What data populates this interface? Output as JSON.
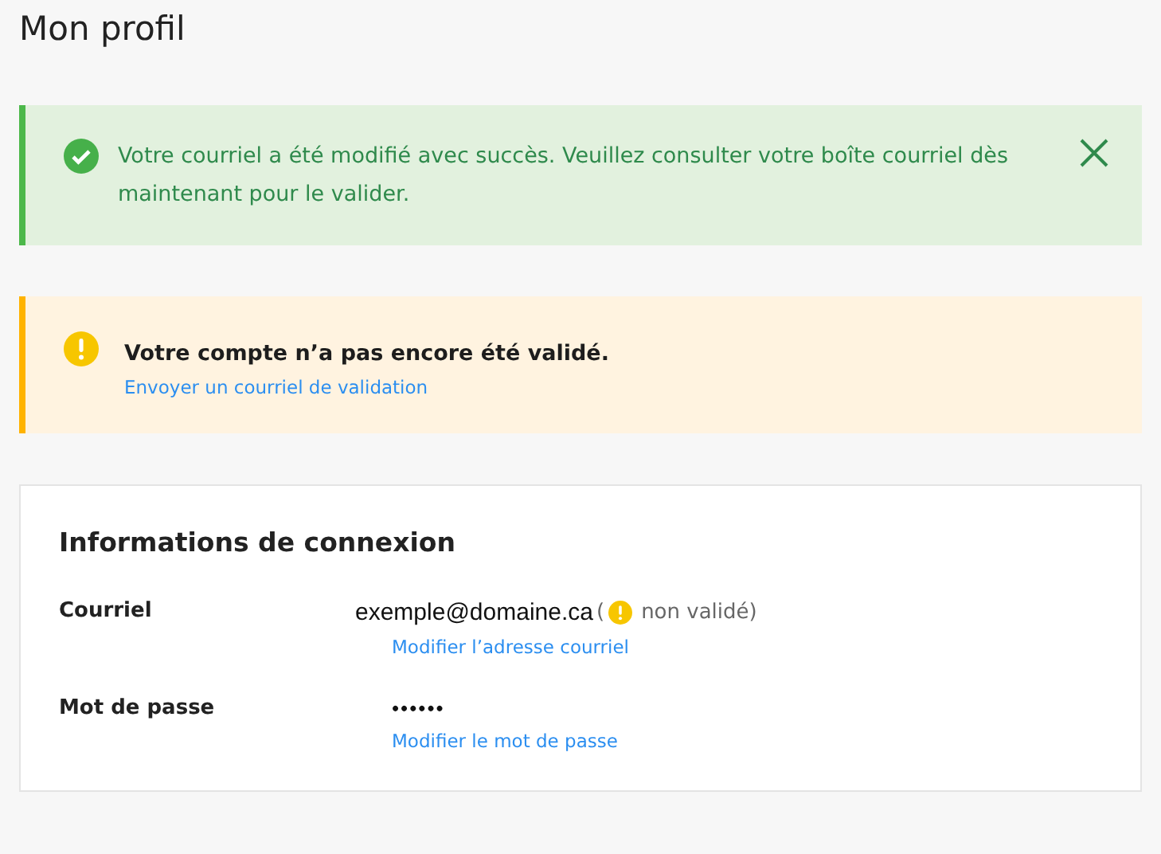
{
  "page_title": "Mon profil",
  "alerts": [
    {
      "kind": "success",
      "message": "Votre courriel a été modifié avec succès. Veuillez consulter votre boîte courriel dès maintenant pour le valider.",
      "dismissible": true
    },
    {
      "kind": "warning",
      "message": "Votre compte n’a pas encore été validé.",
      "link": "Envoyer un courriel de validation"
    }
  ],
  "card": {
    "title": "Informations de connexion",
    "rows": [
      {
        "kind": "email",
        "label": "Courriel",
        "value": "exemple@domaine.ca",
        "open_paren": "(",
        "status": "non validé)",
        "link": "Modifier l’adresse courriel"
      },
      {
        "kind": "password",
        "label": "Mot de passe",
        "value": "••••••",
        "link": "Modifier le mot de passe"
      }
    ]
  }
}
